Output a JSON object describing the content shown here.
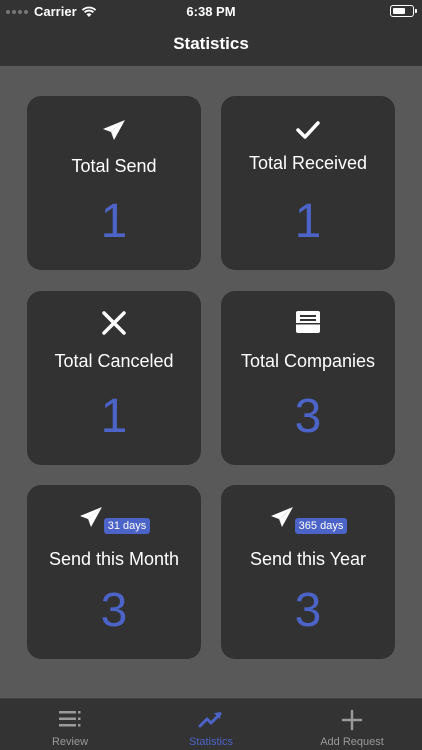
{
  "status": {
    "carrier": "Carrier",
    "time": "6:38 PM"
  },
  "nav": {
    "title": "Statistics"
  },
  "cards": {
    "total_send": {
      "label": "Total Send",
      "value": "1",
      "icon": "paper-plane-icon"
    },
    "total_received": {
      "label": "Total Received",
      "value": "1",
      "icon": "checkmark-icon"
    },
    "total_canceled": {
      "label": "Total Canceled",
      "value": "1",
      "icon": "close-icon"
    },
    "total_companies": {
      "label": "Total Companies",
      "value": "3",
      "icon": "inbox-tray-icon"
    },
    "send_month": {
      "label": "Send this Month",
      "value": "3",
      "badge": "31 days",
      "icon": "paper-plane-icon"
    },
    "send_year": {
      "label": "Send this Year",
      "value": "3",
      "badge": "365 days",
      "icon": "paper-plane-icon"
    }
  },
  "tabs": [
    {
      "label": "Review",
      "icon": "list-icon",
      "active": false
    },
    {
      "label": "Statistics",
      "icon": "trend-up-icon",
      "active": true
    },
    {
      "label": "Add Request",
      "icon": "plus-icon",
      "active": false
    }
  ],
  "colors": {
    "accent": "#4c63c7",
    "card": "#323232",
    "background": "#595959",
    "bars": "#333333"
  }
}
